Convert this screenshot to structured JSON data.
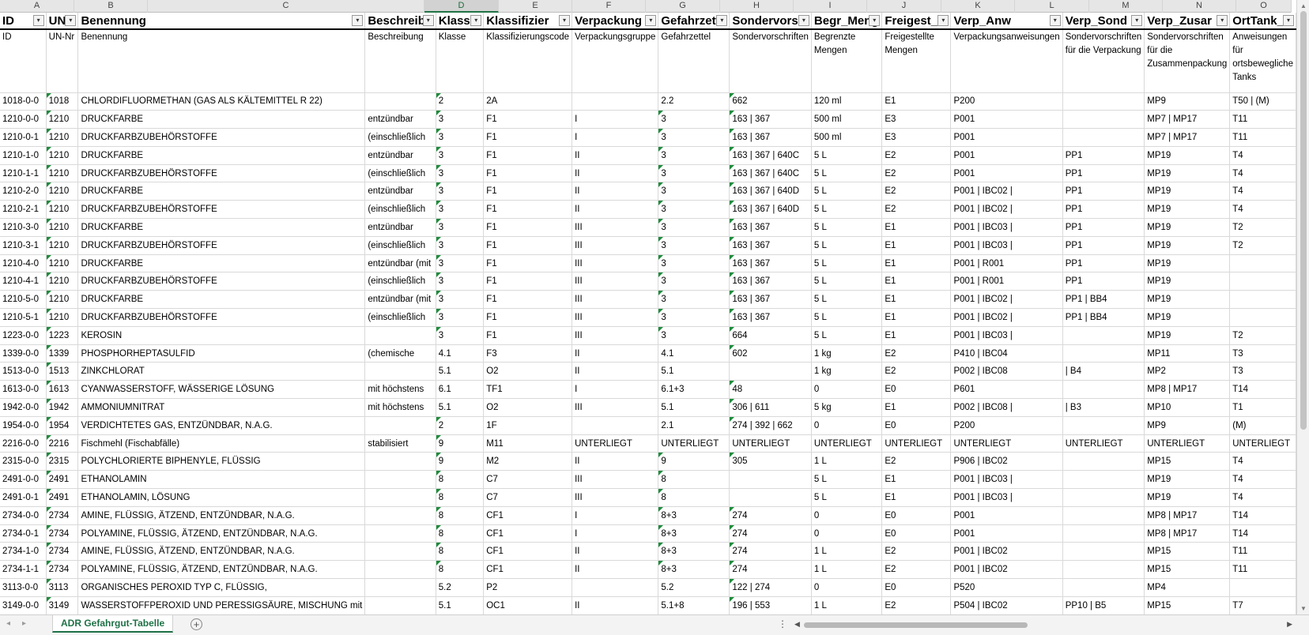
{
  "sheet": {
    "columns": [
      "A",
      "B",
      "C",
      "D",
      "E",
      "F",
      "G",
      "H",
      "I",
      "J",
      "K",
      "L",
      "M",
      "N",
      "O"
    ],
    "selected_column": "D",
    "header_row1": [
      "ID",
      "UN",
      "Benennung",
      "Beschreibu",
      "Klasse",
      "Klassifizier",
      "Verpackung",
      "Gefahrzette",
      "Sondervors",
      "Begr_Meng",
      "Freigest_M",
      "Verp_Anw",
      "Verp_Sond",
      "Verp_Zusar",
      "OrtTank_A"
    ],
    "header_row2": [
      "ID",
      "UN-Nr",
      "Benennung",
      "Beschreibung",
      "Klasse",
      "Klassifizierungscode",
      "Verpackungsgruppe",
      "Gefahrzettel",
      "Sondervorschriften",
      "Begrenzte Mengen",
      "Freigestellte Mengen",
      "Verpackungsanweisungen",
      "Sondervorschriften für die Verpackung",
      "Sondervorschriften für die Zusammenpackung",
      "Anweisungen für ortsbewegliche Tanks"
    ],
    "rows": [
      [
        "1018-0-0",
        "1018",
        "CHLORDIFLUORMETHAN (GAS ALS KÄLTEMITTEL R 22)",
        "",
        "2",
        "2A",
        "",
        "2.2",
        "662",
        "120 ml",
        "E1",
        "P200",
        "",
        "MP9",
        "T50 | (M)"
      ],
      [
        "1210-0-0",
        "1210",
        "DRUCKFARBE",
        "entzündbar",
        "3",
        "F1",
        "I",
        "3",
        "163 | 367",
        "500 ml",
        "E3",
        "P001",
        "",
        "MP7 | MP17",
        "T11"
      ],
      [
        "1210-0-1",
        "1210",
        "DRUCKFARBZUBEHÖRSTOFFE",
        "(einschließlich",
        "3",
        "F1",
        "I",
        "3",
        "163 | 367",
        "500 ml",
        "E3",
        "P001",
        "",
        "MP7 | MP17",
        "T11"
      ],
      [
        "1210-1-0",
        "1210",
        "DRUCKFARBE",
        "entzündbar",
        "3",
        "F1",
        "II",
        "3",
        "163 | 367 | 640C",
        "5 L",
        "E2",
        "P001",
        "PP1",
        "MP19",
        "T4"
      ],
      [
        "1210-1-1",
        "1210",
        "DRUCKFARBZUBEHÖRSTOFFE",
        "(einschließlich",
        "3",
        "F1",
        "II",
        "3",
        "163 | 367 | 640C",
        "5 L",
        "E2",
        "P001",
        "PP1",
        "MP19",
        "T4"
      ],
      [
        "1210-2-0",
        "1210",
        "DRUCKFARBE",
        "entzündbar",
        "3",
        "F1",
        "II",
        "3",
        "163 | 367 | 640D",
        "5 L",
        "E2",
        "P001 | IBC02 |",
        "PP1",
        "MP19",
        "T4"
      ],
      [
        "1210-2-1",
        "1210",
        "DRUCKFARBZUBEHÖRSTOFFE",
        "(einschließlich",
        "3",
        "F1",
        "II",
        "3",
        "163 | 367 | 640D",
        "5 L",
        "E2",
        "P001 | IBC02 |",
        "PP1",
        "MP19",
        "T4"
      ],
      [
        "1210-3-0",
        "1210",
        "DRUCKFARBE",
        "entzündbar",
        "3",
        "F1",
        "III",
        "3",
        "163 | 367",
        "5 L",
        "E1",
        "P001 | IBC03 |",
        "PP1",
        "MP19",
        "T2"
      ],
      [
        "1210-3-1",
        "1210",
        "DRUCKFARBZUBEHÖRSTOFFE",
        "(einschließlich",
        "3",
        "F1",
        "III",
        "3",
        "163 | 367",
        "5 L",
        "E1",
        "P001 | IBC03 |",
        "PP1",
        "MP19",
        "T2"
      ],
      [
        "1210-4-0",
        "1210",
        "DRUCKFARBE",
        "entzündbar (mit",
        "3",
        "F1",
        "III",
        "3",
        "163 | 367",
        "5 L",
        "E1",
        "P001 | R001",
        "PP1",
        "MP19",
        ""
      ],
      [
        "1210-4-1",
        "1210",
        "DRUCKFARBZUBEHÖRSTOFFE",
        "(einschließlich",
        "3",
        "F1",
        "III",
        "3",
        "163 | 367",
        "5 L",
        "E1",
        "P001 | R001",
        "PP1",
        "MP19",
        ""
      ],
      [
        "1210-5-0",
        "1210",
        "DRUCKFARBE",
        "entzündbar (mit",
        "3",
        "F1",
        "III",
        "3",
        "163 | 367",
        "5 L",
        "E1",
        "P001 | IBC02 |",
        "PP1 | BB4",
        "MP19",
        ""
      ],
      [
        "1210-5-1",
        "1210",
        "DRUCKFARBZUBEHÖRSTOFFE",
        "(einschließlich",
        "3",
        "F1",
        "III",
        "3",
        "163 | 367",
        "5 L",
        "E1",
        "P001 | IBC02 |",
        "PP1 | BB4",
        "MP19",
        ""
      ],
      [
        "1223-0-0",
        "1223",
        "KEROSIN",
        "",
        "3",
        "F1",
        "III",
        "3",
        "664",
        "5 L",
        "E1",
        "P001 | IBC03 |",
        "",
        "MP19",
        "T2"
      ],
      [
        "1339-0-0",
        "1339",
        "PHOSPHORHEPTASULFID",
        "(chemische",
        "4.1",
        "F3",
        "II",
        "4.1",
        "602",
        "1 kg",
        "E2",
        "P410 | IBC04",
        "",
        "MP11",
        "T3"
      ],
      [
        "1513-0-0",
        "1513",
        "ZINKCHLORAT",
        "",
        "5.1",
        "O2",
        "II",
        "5.1",
        "",
        "1 kg",
        "E2",
        "P002 | IBC08",
        "| B4",
        "MP2",
        "T3"
      ],
      [
        "1613-0-0",
        "1613",
        "CYANWASSERSTOFF, WÄSSERIGE LÖSUNG",
        "mit höchstens",
        "6.1",
        "TF1",
        "I",
        "6.1+3",
        "48",
        "0",
        "E0",
        "P601",
        "",
        "MP8 | MP17",
        "T14"
      ],
      [
        "1942-0-0",
        "1942",
        "AMMONIUMNITRAT",
        "mit höchstens",
        "5.1",
        "O2",
        "III",
        "5.1",
        "306 | 611",
        "5 kg",
        "E1",
        "P002 | IBC08 |",
        "| B3",
        "MP10",
        "T1"
      ],
      [
        "1954-0-0",
        "1954",
        "VERDICHTETES GAS, ENTZÜNDBAR, N.A.G.",
        "",
        "2",
        "1F",
        "",
        "2.1",
        "274 | 392 | 662",
        "0",
        "E0",
        "P200",
        "",
        "MP9",
        "(M)"
      ],
      [
        "2216-0-0",
        "2216",
        "Fischmehl (Fischabfälle)",
        "stabilisiert",
        "9",
        "M11",
        "UNTERLIEGT",
        "UNTERLIEGT",
        "UNTERLIEGT",
        "UNTERLIEGT",
        "UNTERLIEGT",
        "UNTERLIEGT",
        "UNTERLIEGT",
        "UNTERLIEGT",
        "UNTERLIEGT"
      ],
      [
        "2315-0-0",
        "2315",
        "POLYCHLORIERTE BIPHENYLE, FLÜSSIG",
        "",
        "9",
        "M2",
        "II",
        "9",
        "305",
        "1 L",
        "E2",
        "P906 | IBC02",
        "",
        "MP15",
        "T4"
      ],
      [
        "2491-0-0",
        "2491",
        "ETHANOLAMIN",
        "",
        "8",
        "C7",
        "III",
        "8",
        "",
        "5 L",
        "E1",
        "P001 | IBC03 |",
        "",
        "MP19",
        "T4"
      ],
      [
        "2491-0-1",
        "2491",
        "ETHANOLAMIN, LÖSUNG",
        "",
        "8",
        "C7",
        "III",
        "8",
        "",
        "5 L",
        "E1",
        "P001 | IBC03 |",
        "",
        "MP19",
        "T4"
      ],
      [
        "2734-0-0",
        "2734",
        "AMINE, FLÜSSIG, ÄTZEND, ENTZÜNDBAR, N.A.G.",
        "",
        "8",
        "CF1",
        "I",
        "8+3",
        "274",
        "0",
        "E0",
        "P001",
        "",
        "MP8 | MP17",
        "T14"
      ],
      [
        "2734-0-1",
        "2734",
        "POLYAMINE, FLÜSSIG, ÄTZEND, ENTZÜNDBAR, N.A.G.",
        "",
        "8",
        "CF1",
        "I",
        "8+3",
        "274",
        "0",
        "E0",
        "P001",
        "",
        "MP8 | MP17",
        "T14"
      ],
      [
        "2734-1-0",
        "2734",
        "AMINE, FLÜSSIG, ÄTZEND, ENTZÜNDBAR, N.A.G.",
        "",
        "8",
        "CF1",
        "II",
        "8+3",
        "274",
        "1 L",
        "E2",
        "P001 | IBC02",
        "",
        "MP15",
        "T11"
      ],
      [
        "2734-1-1",
        "2734",
        "POLYAMINE, FLÜSSIG, ÄTZEND, ENTZÜNDBAR, N.A.G.",
        "",
        "8",
        "CF1",
        "II",
        "8+3",
        "274",
        "1 L",
        "E2",
        "P001 | IBC02",
        "",
        "MP15",
        "T11"
      ],
      [
        "3113-0-0",
        "3113",
        "ORGANISCHES PEROXID TYP C, FLÜSSIG,",
        "",
        "5.2",
        "P2",
        "",
        "5.2",
        "122 | 274",
        "0",
        "E0",
        "P520",
        "",
        "MP4",
        ""
      ],
      [
        "3149-0-0",
        "3149",
        "WASSERSTOFFPEROXID UND PERESSIGSÄURE, MISCHUNG mit",
        "",
        "5.1",
        "OC1",
        "II",
        "5.1+8",
        "196 | 553",
        "1 L",
        "E2",
        "P504 | IBC02",
        "PP10 | B5",
        "MP15",
        "T7"
      ]
    ]
  },
  "tabs": {
    "active_sheet": "ADR Gefahrgut-Tabelle",
    "add_sheet_label": "+",
    "more_label": "⋮",
    "nav_prev": "◂",
    "nav_next": "▸"
  },
  "colors": {
    "accent": "#217346",
    "comment_marker": "#1e8b3c"
  }
}
